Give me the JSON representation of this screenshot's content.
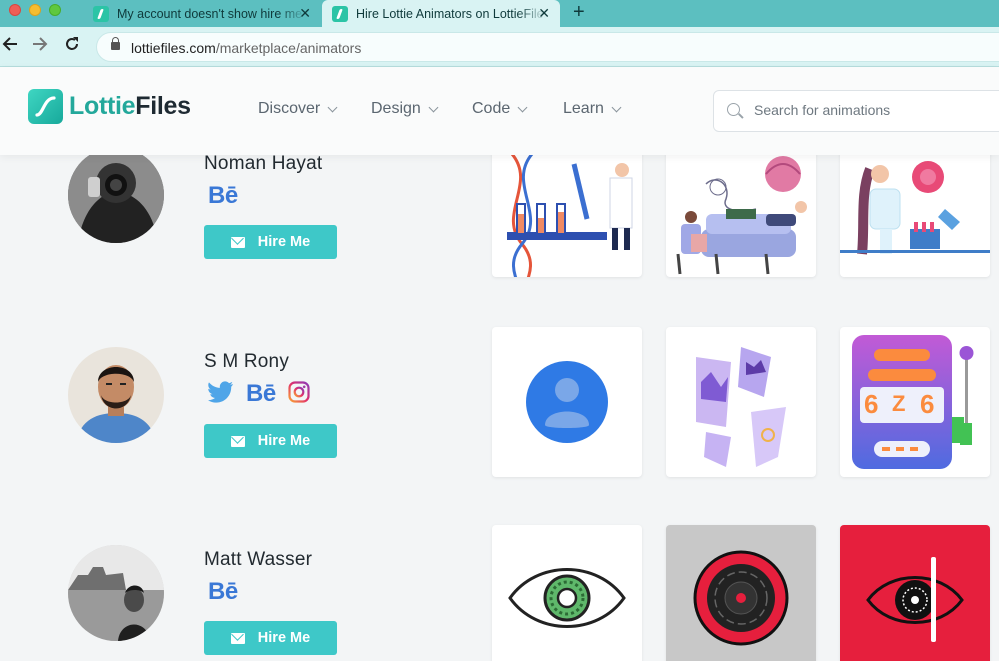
{
  "browser": {
    "tabs": [
      {
        "title": "My account doesn't show hire me button",
        "active": false
      },
      {
        "title": "Hire Lottie Animators on LottieFiles",
        "active": true
      }
    ],
    "url_host": "lottiefiles.com",
    "url_path": "/marketplace/animators"
  },
  "header": {
    "logo_lottie": "Lottie",
    "logo_files": "Files",
    "menu": [
      "Discover",
      "Design",
      "Code",
      "Learn"
    ],
    "search_placeholder": "Search for animations"
  },
  "animators": [
    {
      "name": "Noman Hayat",
      "socials": [
        "behance"
      ],
      "hire_label": "Hire Me"
    },
    {
      "name": "S M Rony",
      "socials": [
        "twitter",
        "behance",
        "instagram"
      ],
      "hire_label": "Hire Me"
    },
    {
      "name": "Matt Wasser",
      "socials": [
        "behance"
      ],
      "hire_label": "Hire Me"
    }
  ],
  "social_labels": {
    "behance": "Bē"
  },
  "colors": {
    "brand": "#23a89b",
    "hire_button": "#3ec8c8",
    "behance": "#3a78d6",
    "twitter": "#4fa5e8",
    "card_red": "#e61f3d",
    "card_gray": "#c8c8c8"
  }
}
